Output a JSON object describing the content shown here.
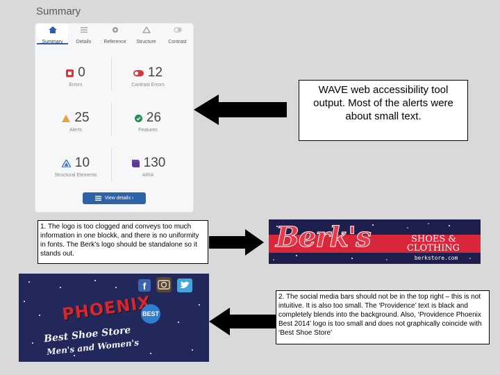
{
  "summary": {
    "title": "Summary"
  },
  "tabs": [
    {
      "label": "Summary",
      "icon": "home-icon",
      "active": true
    },
    {
      "label": "Details",
      "icon": "list-icon",
      "active": false
    },
    {
      "label": "Reference",
      "icon": "gear-icon",
      "active": false
    },
    {
      "label": "Structure",
      "icon": "structure-icon",
      "active": false
    },
    {
      "label": "Contrast",
      "icon": "contrast-icon",
      "active": false
    }
  ],
  "stats": {
    "errors": {
      "value": "0",
      "label": "Errors",
      "color": "#d9363e"
    },
    "contrast_errors": {
      "value": "12",
      "label": "Contrast Errors",
      "color": "#d9363e"
    },
    "alerts": {
      "value": "25",
      "label": "Alerts",
      "color": "#e9a13b"
    },
    "features": {
      "value": "26",
      "label": "Features",
      "color": "#2e8b57"
    },
    "structural": {
      "value": "10",
      "label": "Structural Elements",
      "color": "#3b6fc4"
    },
    "aria": {
      "value": "130",
      "label": "ARIA",
      "color": "#5a3a92"
    }
  },
  "view_details": {
    "label": "View details ›"
  },
  "callouts": {
    "wave": "WAVE web accessibility tool output. Most of the alerts were about small text.",
    "berks": "1. The logo is too clogged and conveys too much information in one blockk, and there is no uniformity in fonts. The Berk’s logo should be standalone so it stands out.",
    "social": "2. The social media bars should not be in the top right – this is not intuitive. It is also too small. The ‘Providence’ text is black and completely blends into the background. Also, ‘Providence Phoenix Best 2014’ logo is too small and does not graphically coincide with ‘Best Shoe Store’"
  },
  "berks_logo": {
    "script": "Berk's",
    "line1": "SHOES &",
    "line2": "CLOTHING",
    "url": "berkstore.com"
  },
  "phoenix_banner": {
    "logo": "PHOENIX",
    "best": "BEST",
    "tagline1": "Best Shoe Store",
    "tagline2": "Men's and Women's"
  }
}
